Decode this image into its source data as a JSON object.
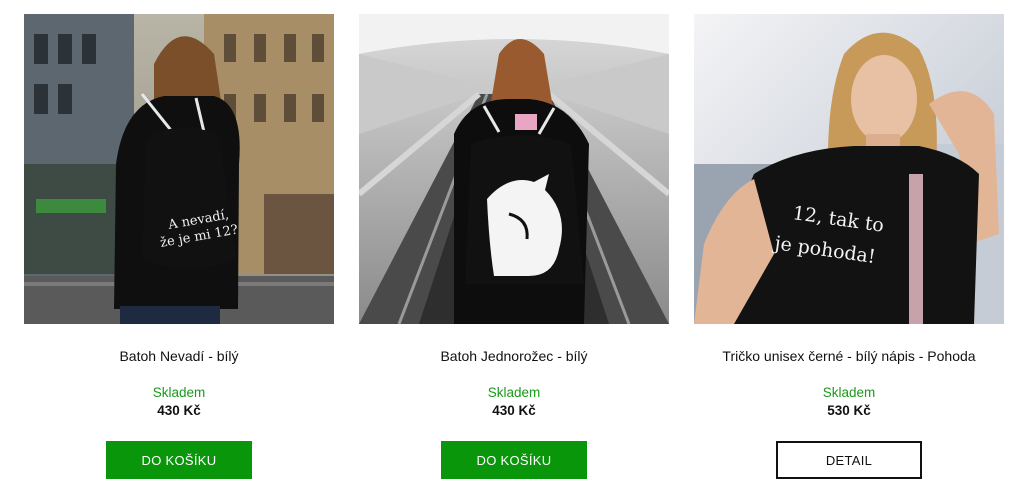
{
  "products": [
    {
      "name": "Batoh Nevadí - bílý",
      "image_text": "A nevadí, že je mi 12?",
      "availability": "Skladem",
      "price": "430 Kč",
      "button_label": "DO KOŠÍKU"
    },
    {
      "name": "Batoh Jednorožec - bílý",
      "image_text": "",
      "availability": "Skladem",
      "price": "430 Kč",
      "button_label": "DO KOŠÍKU"
    },
    {
      "name": "Tričko unisex černé - bílý nápis - Pohoda",
      "image_text": "12, tak to je pohoda!",
      "availability": "Skladem",
      "price": "530 Kč",
      "button_label": "DETAIL"
    }
  ],
  "colors": {
    "stock_green": "#1a9a1a",
    "cart_button": "#0a960a",
    "detail_border": "#111111"
  }
}
